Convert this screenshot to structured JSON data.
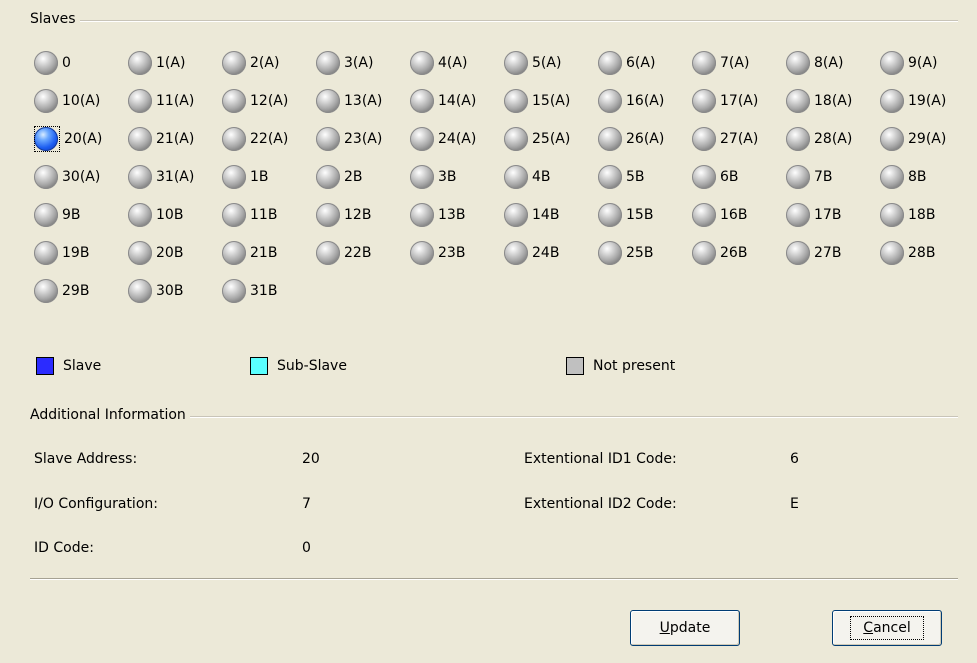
{
  "slaves_group": {
    "title": "Slaves",
    "items": [
      {
        "label": "0",
        "state": "off"
      },
      {
        "label": "1(A)",
        "state": "off"
      },
      {
        "label": "2(A)",
        "state": "off"
      },
      {
        "label": "3(A)",
        "state": "off"
      },
      {
        "label": "4(A)",
        "state": "off"
      },
      {
        "label": "5(A)",
        "state": "off"
      },
      {
        "label": "6(A)",
        "state": "off"
      },
      {
        "label": "7(A)",
        "state": "off"
      },
      {
        "label": "8(A)",
        "state": "off"
      },
      {
        "label": "9(A)",
        "state": "off"
      },
      {
        "label": "10(A)",
        "state": "off"
      },
      {
        "label": "11(A)",
        "state": "off"
      },
      {
        "label": "12(A)",
        "state": "off"
      },
      {
        "label": "13(A)",
        "state": "off"
      },
      {
        "label": "14(A)",
        "state": "off"
      },
      {
        "label": "15(A)",
        "state": "off"
      },
      {
        "label": "16(A)",
        "state": "off"
      },
      {
        "label": "17(A)",
        "state": "off"
      },
      {
        "label": "18(A)",
        "state": "off"
      },
      {
        "label": "19(A)",
        "state": "off"
      },
      {
        "label": "20(A)",
        "state": "slave"
      },
      {
        "label": "21(A)",
        "state": "off"
      },
      {
        "label": "22(A)",
        "state": "off"
      },
      {
        "label": "23(A)",
        "state": "off"
      },
      {
        "label": "24(A)",
        "state": "off"
      },
      {
        "label": "25(A)",
        "state": "off"
      },
      {
        "label": "26(A)",
        "state": "off"
      },
      {
        "label": "27(A)",
        "state": "off"
      },
      {
        "label": "28(A)",
        "state": "off"
      },
      {
        "label": "29(A)",
        "state": "off"
      },
      {
        "label": "30(A)",
        "state": "off"
      },
      {
        "label": "31(A)",
        "state": "off"
      },
      {
        "label": "1B",
        "state": "off"
      },
      {
        "label": "2B",
        "state": "off"
      },
      {
        "label": "3B",
        "state": "off"
      },
      {
        "label": "4B",
        "state": "off"
      },
      {
        "label": "5B",
        "state": "off"
      },
      {
        "label": "6B",
        "state": "off"
      },
      {
        "label": "7B",
        "state": "off"
      },
      {
        "label": "8B",
        "state": "off"
      },
      {
        "label": "9B",
        "state": "off"
      },
      {
        "label": "10B",
        "state": "off"
      },
      {
        "label": "11B",
        "state": "off"
      },
      {
        "label": "12B",
        "state": "off"
      },
      {
        "label": "13B",
        "state": "off"
      },
      {
        "label": "14B",
        "state": "off"
      },
      {
        "label": "15B",
        "state": "off"
      },
      {
        "label": "16B",
        "state": "off"
      },
      {
        "label": "17B",
        "state": "off"
      },
      {
        "label": "18B",
        "state": "off"
      },
      {
        "label": "19B",
        "state": "off"
      },
      {
        "label": "20B",
        "state": "off"
      },
      {
        "label": "21B",
        "state": "off"
      },
      {
        "label": "22B",
        "state": "off"
      },
      {
        "label": "23B",
        "state": "off"
      },
      {
        "label": "24B",
        "state": "off"
      },
      {
        "label": "25B",
        "state": "off"
      },
      {
        "label": "26B",
        "state": "off"
      },
      {
        "label": "27B",
        "state": "off"
      },
      {
        "label": "28B",
        "state": "off"
      },
      {
        "label": "29B",
        "state": "off"
      },
      {
        "label": "30B",
        "state": "off"
      },
      {
        "label": "31B",
        "state": "off"
      }
    ]
  },
  "legend": {
    "slave": {
      "label": "Slave",
      "color": "#2b2bff"
    },
    "sub_slave": {
      "label": "Sub-Slave",
      "color": "#5affff"
    },
    "not_present": {
      "label": "Not present",
      "color": "#c0c0c0"
    }
  },
  "additional_info": {
    "title": "Additional Information",
    "slave_address_label": "Slave Address:",
    "slave_address_value": "20",
    "io_config_label": "I/O Configuration:",
    "io_config_value": "7",
    "id_code_label": "ID Code:",
    "id_code_value": "0",
    "ext_id1_label": "Extentional ID1 Code:",
    "ext_id1_value": "6",
    "ext_id2_label": "Extentional ID2 Code:",
    "ext_id2_value": "E"
  },
  "buttons": {
    "update_mnemonic": "U",
    "update_rest": "pdate",
    "cancel_mnemonic": "C",
    "cancel_rest": "ancel"
  }
}
